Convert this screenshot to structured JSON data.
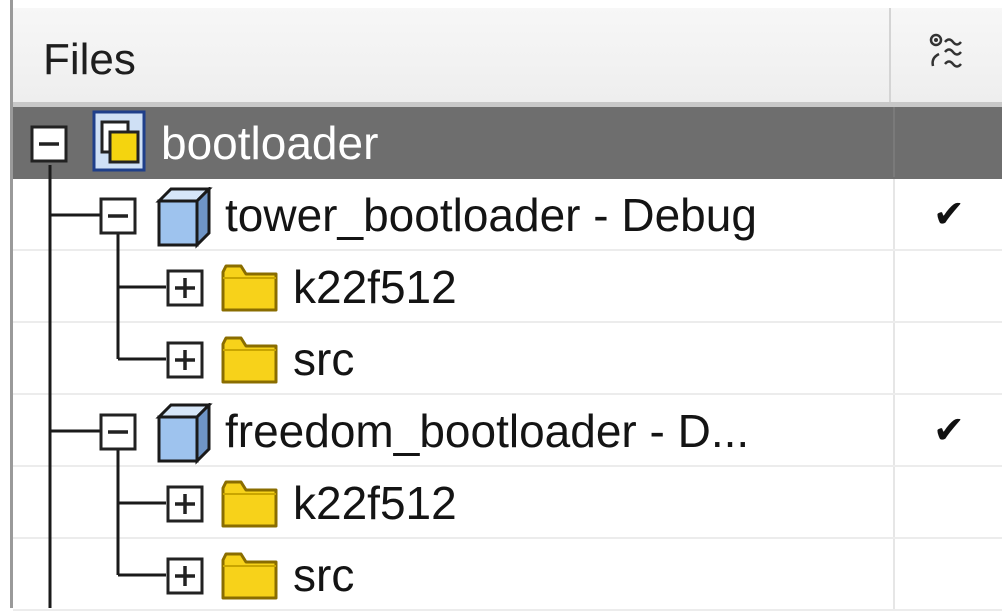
{
  "header": {
    "files_label": "Files",
    "check_column_icon": "options-column-icon"
  },
  "tree": {
    "root": {
      "label": "bootloader",
      "icon": "workspace-icon",
      "expanded": true,
      "selected": true
    },
    "projects": [
      {
        "label": "tower_bootloader - Debug",
        "icon": "project-cube-icon",
        "expanded": true,
        "checked": "✔",
        "children": [
          {
            "label": "k22f512",
            "icon": "folder-icon",
            "expanded": false
          },
          {
            "label": "src",
            "icon": "folder-icon",
            "expanded": false
          }
        ]
      },
      {
        "label": "freedom_bootloader - D...",
        "icon": "project-cube-icon",
        "expanded": true,
        "checked": "✔",
        "children": [
          {
            "label": "k22f512",
            "icon": "folder-icon",
            "expanded": false
          },
          {
            "label": "src",
            "icon": "folder-icon",
            "expanded": false
          }
        ]
      }
    ]
  },
  "colors": {
    "selection": "#6e6e6e",
    "folder": "#f7d21a",
    "cube": "#9ec3ee"
  }
}
